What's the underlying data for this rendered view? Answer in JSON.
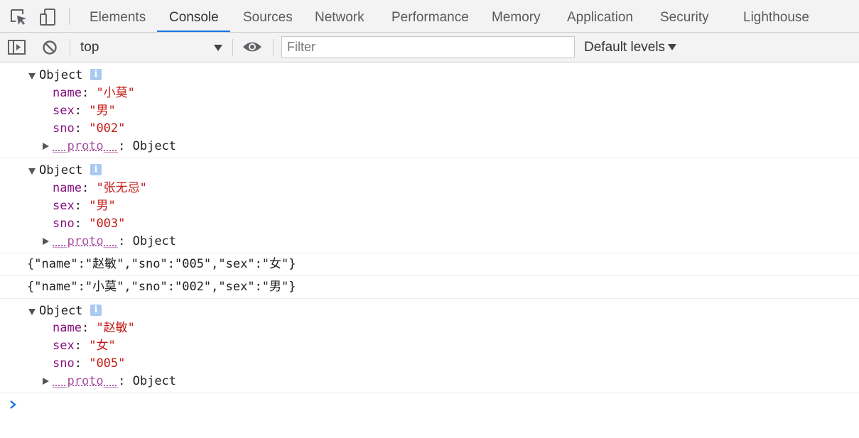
{
  "tabs": [
    "Elements",
    "Console",
    "Sources",
    "Network",
    "Performance",
    "Memory",
    "Application",
    "Security",
    "Lighthouse"
  ],
  "active_tab": "Console",
  "toolbar": {
    "context": "top",
    "filter_placeholder": "Filter",
    "levels_label": "Default levels"
  },
  "messages": [
    {
      "type": "object",
      "label": "Object",
      "info": "i",
      "props": [
        {
          "key": "name",
          "value": "\"小莫\""
        },
        {
          "key": "sex",
          "value": "\"男\""
        },
        {
          "key": "sno",
          "value": "\"002\""
        }
      ],
      "proto_key": "__proto__",
      "proto_value": "Object"
    },
    {
      "type": "object",
      "label": "Object",
      "info": "i",
      "props": [
        {
          "key": "name",
          "value": "\"张无忌\""
        },
        {
          "key": "sex",
          "value": "\"男\""
        },
        {
          "key": "sno",
          "value": "\"003\""
        }
      ],
      "proto_key": "__proto__",
      "proto_value": "Object"
    },
    {
      "type": "text",
      "text": "{\"name\":\"赵敏\",\"sno\":\"005\",\"sex\":\"女\"}"
    },
    {
      "type": "text",
      "text": "{\"name\":\"小莫\",\"sno\":\"002\",\"sex\":\"男\"}"
    },
    {
      "type": "object",
      "label": "Object",
      "info": "i",
      "props": [
        {
          "key": "name",
          "value": "\"赵敏\""
        },
        {
          "key": "sex",
          "value": "\"女\""
        },
        {
          "key": "sno",
          "value": "\"005\""
        }
      ],
      "proto_key": "__proto__",
      "proto_value": "Object"
    }
  ],
  "colors": {
    "accent": "#1a73e8",
    "key": "#881280",
    "string": "#c41a16",
    "info_badge": "#a9c9f3"
  },
  "icons": [
    "inspect-element-icon",
    "device-toolbar-icon",
    "sidebar-toggle-icon",
    "clear-console-icon",
    "eye-icon",
    "prompt-chevron-icon"
  ]
}
